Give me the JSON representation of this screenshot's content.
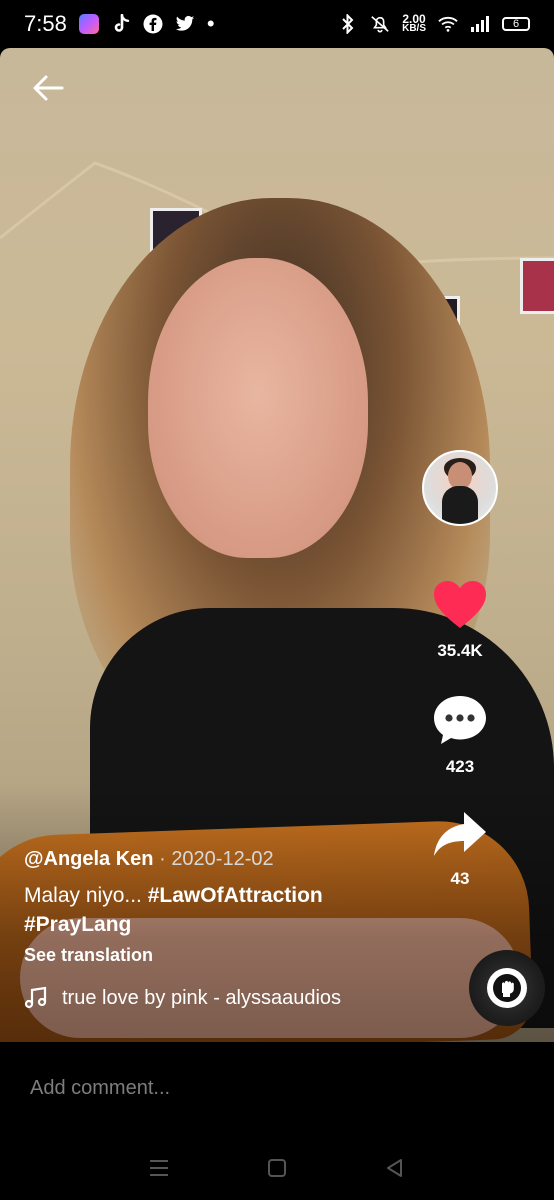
{
  "status_bar": {
    "time": "7:58",
    "net_speed_value": "2.00",
    "net_speed_unit": "KB/S",
    "battery": "6",
    "notification_icons": [
      "app-icon",
      "tiktok-icon",
      "facebook-icon",
      "twitter-icon",
      "dot-icon"
    ],
    "system_icons": [
      "bluetooth-icon",
      "mute-icon",
      "wifi-icon",
      "signal-icon",
      "battery-icon"
    ]
  },
  "video": {
    "creator": "@Angela Ken",
    "date_separator": " · ",
    "date": "2020-12-02",
    "description_text": "Malay niyo... ",
    "hashtag_1": "#LawOfAttraction",
    "hashtag_2": "#PrayLang",
    "see_translation": "See translation",
    "music": "true love by pink - alyssaaudios"
  },
  "actions": {
    "likes": "35.4K",
    "comments": "423",
    "shares": "43",
    "like_color": "#fe2c55"
  },
  "comment": {
    "placeholder": "Add comment..."
  }
}
